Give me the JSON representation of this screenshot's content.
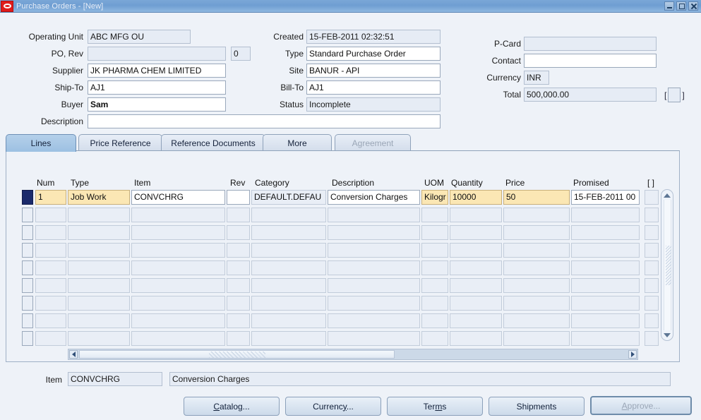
{
  "window": {
    "title": "Purchase Orders - [New]",
    "logo_icon": "oracle-logo-icon",
    "minimize_icon": "minimize-icon",
    "maximize_icon": "maximize-icon",
    "close_icon": "close-icon"
  },
  "header": {
    "operating_unit": {
      "label": "Operating Unit",
      "value": "ABC MFG OU"
    },
    "po_rev": {
      "label": "PO, Rev",
      "po_value": "",
      "rev_value": "0"
    },
    "supplier": {
      "label": "Supplier",
      "value": "JK PHARMA CHEM LIMITED"
    },
    "ship_to": {
      "label": "Ship-To",
      "value": "AJ1"
    },
    "buyer": {
      "label": "Buyer",
      "value": "Sam"
    },
    "description": {
      "label": "Description",
      "value": ""
    },
    "created": {
      "label": "Created",
      "value": "15-FEB-2011 02:32:51"
    },
    "type": {
      "label": "Type",
      "value": "Standard Purchase Order"
    },
    "site": {
      "label": "Site",
      "value": "BANUR - API"
    },
    "bill_to": {
      "label": "Bill-To",
      "value": "AJ1"
    },
    "status": {
      "label": "Status",
      "value": "Incomplete"
    },
    "p_card": {
      "label": "P-Card",
      "value": ""
    },
    "contact": {
      "label": "Contact",
      "value": ""
    },
    "currency": {
      "label": "Currency",
      "value": "INR"
    },
    "total": {
      "label": "Total",
      "value": "500,000.00"
    },
    "total_flexfield": {
      "open": "[",
      "close": "]"
    }
  },
  "tabs": [
    {
      "label": "Lines",
      "state": "active"
    },
    {
      "label": "Price Reference",
      "state": "normal"
    },
    {
      "label": "Reference Documents",
      "state": "normal"
    },
    {
      "label": "More",
      "state": "normal"
    },
    {
      "label": "Agreement",
      "state": "disabled"
    }
  ],
  "lines_grid": {
    "columns": [
      "Num",
      "Type",
      "Item",
      "Rev",
      "Category",
      "Description",
      "UOM",
      "Quantity",
      "Price",
      "Promised",
      "[ ]"
    ],
    "rows": [
      {
        "selected": true,
        "num": "1",
        "type": "Job Work",
        "item": "CONVCHRG",
        "rev": "",
        "category": "DEFAULT.DEFAU",
        "description": "Conversion Charges",
        "uom": "Kilogr",
        "quantity": "10000",
        "price": "50",
        "promised": "15-FEB-2011 00",
        "flex": ""
      }
    ],
    "empty_row_count": 8,
    "vertical_scrollbar": {
      "up_icon": "scroll-up-arrow-icon",
      "down_icon": "scroll-down-arrow-icon"
    },
    "horizontal_scrollbar": {
      "left_icon": "scroll-left-arrow-icon",
      "right_icon": "scroll-right-arrow-icon"
    }
  },
  "detail": {
    "item_label": "Item",
    "item_code": "CONVCHRG",
    "item_description": "Conversion Charges"
  },
  "buttons": [
    {
      "name": "catalog-button",
      "pre": "C",
      "mnemonic": "",
      "post": "atalog...",
      "label": "Catalog...",
      "disabled": false,
      "default": false
    },
    {
      "name": "currency-button",
      "pre": "Currenc",
      "mnemonic": "y",
      "post": "...",
      "label": "Currency...",
      "disabled": false,
      "default": false
    },
    {
      "name": "terms-button",
      "pre": "Ter",
      "mnemonic": "m",
      "post": "s",
      "label": "Terms",
      "disabled": false,
      "default": false
    },
    {
      "name": "shipments-button",
      "pre": "Shipments",
      "mnemonic": "",
      "post": "",
      "label": "Shipments",
      "disabled": false,
      "default": false
    },
    {
      "name": "approve-button",
      "pre": "A",
      "mnemonic": "",
      "post": "pprove...",
      "label": "Approve...",
      "disabled": true,
      "default": true
    }
  ],
  "colors": {
    "titlebar": "#6f9ed2",
    "page_bg": "#eef2f8",
    "readonly_field": "#e6ecf5",
    "required_field": "#fbe7b4",
    "active_tab": "#9cc0e2",
    "record_indicator": "#1b2a6b",
    "oracle_red": "#e01b1b"
  }
}
